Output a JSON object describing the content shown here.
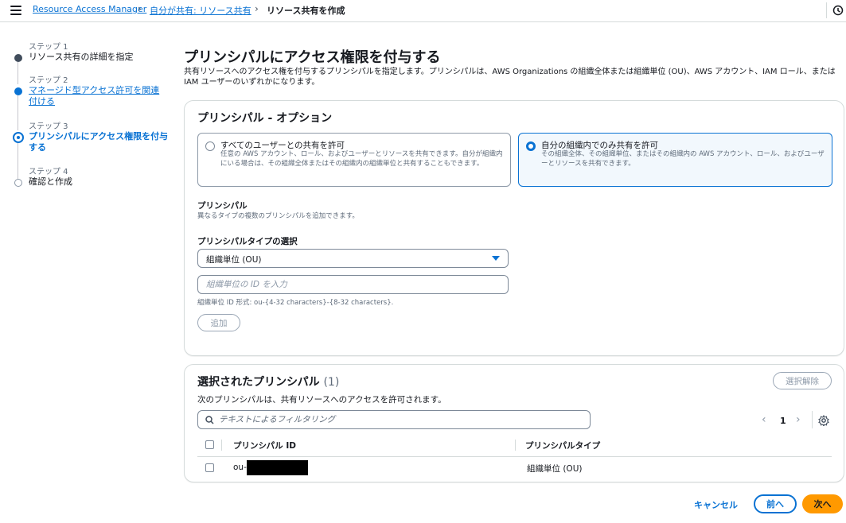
{
  "breadcrumb": {
    "items": [
      {
        "label": "Resource Access Manager"
      },
      {
        "label": "自分が共有: リソース共有"
      },
      {
        "label": "リソース共有を作成"
      }
    ]
  },
  "steps": [
    {
      "number": "ステップ 1",
      "label": "リソース共有の詳細を指定",
      "state": "done"
    },
    {
      "number": "ステップ 2",
      "label": "マネージド型アクセス許可を関連付ける",
      "state": "link"
    },
    {
      "number": "ステップ 3",
      "label": "プリンシパルにアクセス権限を付与する",
      "state": "active"
    },
    {
      "number": "ステップ 4",
      "label": "確認と作成",
      "state": "pending"
    }
  ],
  "page": {
    "title": "プリンシパルにアクセス権限を付与する",
    "description": "共有リソースへのアクセス権を付与するプリンシパルを指定します。プリンシパルは、AWS Organizations の組織全体または組織単位 (OU)、AWS アカウント、IAM ロール、または IAM ユーザーのいずれかになります。"
  },
  "options": {
    "title": "プリンシパル - オプション",
    "radio_all": {
      "title": "すべてのユーザーとの共有を許可",
      "description": "任意の AWS アカウント、ロール、およびユーザーとリソースを共有できます。自分が組織内にいる場合は、その組織全体またはその組織内の組織単位と共有することもできます。",
      "selected": false
    },
    "radio_org": {
      "title": "自分の組織内でのみ共有を許可",
      "description": "その組織全体、その組織単位、またはその組織内の AWS アカウント、ロール、およびユーザーとリソースを共有できます。",
      "selected": true
    },
    "principal_label": "プリンシパル",
    "principal_desc": "異なるタイプの複数のプリンシパルを追加できます。",
    "type_label": "プリンシパルタイプの選択",
    "type_value": "組織単位 (OU)",
    "id_placeholder": "組織単位の ID を入力",
    "id_value": "",
    "id_hint": "組織単位 ID 形式: ou-{4-32 characters}-{8-32 characters}.",
    "add_button": "追加"
  },
  "selected": {
    "title": "選択されたプリンシパル",
    "count": "(1)",
    "clear_button": "選択解除",
    "description": "次のプリンシパルは、共有リソースへのアクセスを許可されます。",
    "filter_placeholder": "テキストによるフィルタリング",
    "page": "1",
    "columns": {
      "id": "プリンシパル ID",
      "type": "プリンシパルタイプ"
    },
    "rows": [
      {
        "id": "ou-",
        "type": "組織単位 (OU)"
      }
    ]
  },
  "footer": {
    "cancel": "キャンセル",
    "previous": "前へ",
    "next": "次へ"
  },
  "colors": {
    "accent": "#0972d3",
    "primary_button": "#ff9900",
    "text": "#16191f"
  },
  "icons": [
    "menu-icon",
    "notification-icon",
    "search-icon",
    "gear-icon",
    "caret-down-icon",
    "chevron-left-icon",
    "chevron-right-icon"
  ]
}
